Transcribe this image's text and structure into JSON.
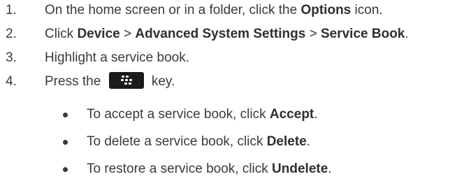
{
  "steps": [
    {
      "number": "1.",
      "before": "On the home screen or in a folder, click the ",
      "bold1": "Options",
      "after": " icon."
    },
    {
      "number": "2.",
      "before": "Click ",
      "bold1": "Device",
      "sep1": " > ",
      "bold2": "Advanced System Settings",
      "sep2": " > ",
      "bold3": "Service Book",
      "after": "."
    },
    {
      "number": "3.",
      "text": "Highlight a service book."
    },
    {
      "number": "4.",
      "before": "Press the ",
      "key_icon": "blackberry-menu-key-icon",
      "after": " key."
    }
  ],
  "bullets": [
    {
      "before": "To accept a service book, click ",
      "bold": "Accept",
      "after": "."
    },
    {
      "before": "To delete a service book, click ",
      "bold": "Delete",
      "after": "."
    },
    {
      "before": "To restore a service book, click ",
      "bold": "Undelete",
      "after": "."
    }
  ],
  "colors": {
    "text": "#3a3a3a",
    "key_background": "#1a1a1a",
    "key_glyph": "#ffffff"
  }
}
